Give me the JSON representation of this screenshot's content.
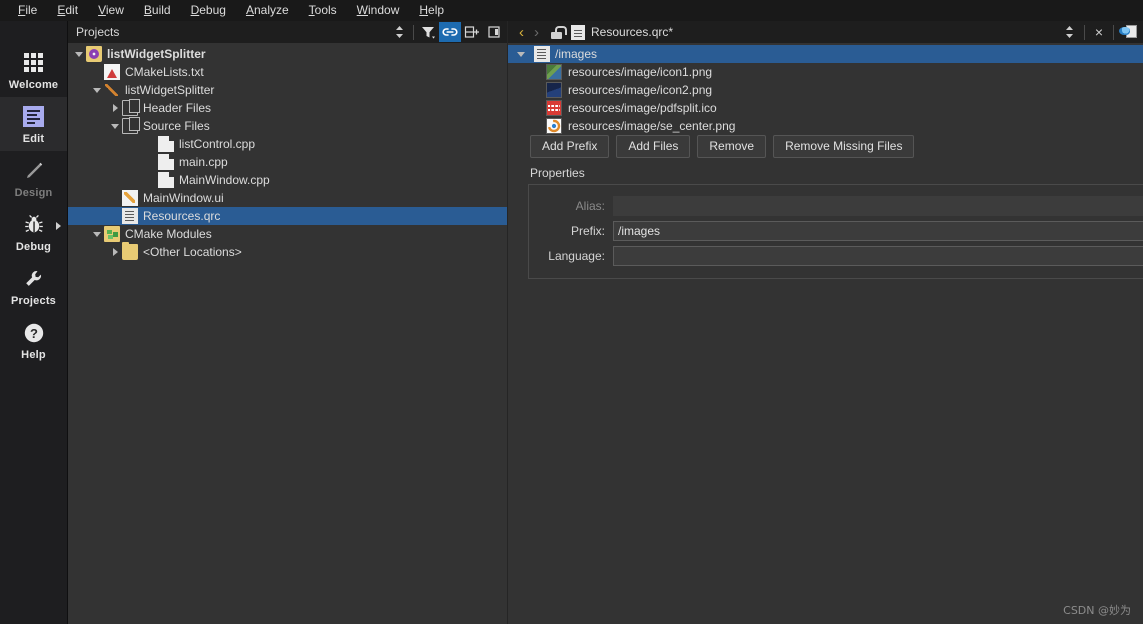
{
  "menubar": {
    "items": [
      {
        "pre": "",
        "mn": "F",
        "post": "ile"
      },
      {
        "pre": "",
        "mn": "E",
        "post": "dit"
      },
      {
        "pre": "",
        "mn": "V",
        "post": "iew"
      },
      {
        "pre": "",
        "mn": "B",
        "post": "uild"
      },
      {
        "pre": "",
        "mn": "D",
        "post": "ebug"
      },
      {
        "pre": "",
        "mn": "A",
        "post": "nalyze"
      },
      {
        "pre": "",
        "mn": "T",
        "post": "ools"
      },
      {
        "pre": "",
        "mn": "W",
        "post": "indow"
      },
      {
        "pre": "",
        "mn": "H",
        "post": "elp"
      }
    ]
  },
  "modebar": {
    "items": [
      {
        "label": "Welcome",
        "icon": "grid-icon",
        "state": "normal"
      },
      {
        "label": "Edit",
        "icon": "document-edit-icon",
        "state": "active"
      },
      {
        "label": "Design",
        "icon": "pencil-icon",
        "state": "disabled"
      },
      {
        "label": "Debug",
        "icon": "bug-icon",
        "state": "normal"
      },
      {
        "label": "Projects",
        "icon": "wrench-icon",
        "state": "normal"
      },
      {
        "label": "Help",
        "icon": "question-mark-icon",
        "state": "normal"
      }
    ]
  },
  "projects_panel": {
    "title": "Projects",
    "toolbar": [
      {
        "name": "sort-updown-icon",
        "active": false
      },
      {
        "name": "filter-funnel-icon",
        "active": false
      },
      {
        "name": "link-chain-icon",
        "active": true
      },
      {
        "name": "split-add-icon",
        "active": false
      },
      {
        "name": "close-panel-icon",
        "active": false
      }
    ],
    "tree": [
      {
        "label": "listWidgetSplitter",
        "indent": 0,
        "twist": "down",
        "icon": "project-gear-icon",
        "bold": true,
        "selected": false
      },
      {
        "label": "CMakeLists.txt",
        "indent": 1,
        "twist": "none",
        "icon": "cmake-file-icon",
        "bold": false,
        "selected": false
      },
      {
        "label": "listWidgetSplitter",
        "indent": 1,
        "twist": "down",
        "icon": "build-target-icon",
        "bold": false,
        "selected": false
      },
      {
        "label": "Header Files",
        "indent": 2,
        "twist": "right",
        "icon": "files-group-icon",
        "bold": false,
        "selected": false
      },
      {
        "label": "Source Files",
        "indent": 2,
        "twist": "down",
        "icon": "files-group-icon",
        "bold": false,
        "selected": false
      },
      {
        "label": "listControl.cpp",
        "indent": 4,
        "twist": "none",
        "icon": "cpp-file-icon",
        "bold": false,
        "selected": false
      },
      {
        "label": "main.cpp",
        "indent": 4,
        "twist": "none",
        "icon": "cpp-file-icon",
        "bold": false,
        "selected": false
      },
      {
        "label": "MainWindow.cpp",
        "indent": 4,
        "twist": "none",
        "icon": "cpp-file-icon",
        "bold": false,
        "selected": false
      },
      {
        "label": "MainWindow.ui",
        "indent": 2,
        "twist": "none",
        "icon": "ui-form-icon",
        "bold": false,
        "selected": false
      },
      {
        "label": "Resources.qrc",
        "indent": 2,
        "twist": "none",
        "icon": "qrc-file-icon",
        "bold": false,
        "selected": true
      },
      {
        "label": "CMake Modules",
        "indent": 1,
        "twist": "down",
        "icon": "cmake-modules-icon",
        "bold": false,
        "selected": false
      },
      {
        "label": "<Other Locations>",
        "indent": 2,
        "twist": "right",
        "icon": "folder-icon",
        "bold": false,
        "selected": false
      }
    ]
  },
  "editor": {
    "nav_back": "‹",
    "nav_forward": "›",
    "lock_icon": "unlocked-padlock-icon",
    "file_icon": "qrc-file-icon",
    "title": "Resources.qrc*",
    "sort_icon": "updown-arrows-icon",
    "close_label": "×",
    "split_icon": "split-editor-icon",
    "resource_tree": [
      {
        "label": "/images",
        "kind": "prefix",
        "twist": "down",
        "icon": "qrc-prefix-icon",
        "selected": true,
        "thumb": "#6aa84f"
      },
      {
        "label": "resources/image/icon1.png",
        "kind": "file",
        "twist": "none",
        "icon": "image-thumb-icon",
        "selected": false,
        "thumb": "icon1"
      },
      {
        "label": "resources/image/icon2.png",
        "kind": "file",
        "twist": "none",
        "icon": "image-thumb-icon",
        "selected": false,
        "thumb": "icon2"
      },
      {
        "label": "resources/image/pdfsplit.ico",
        "kind": "file",
        "twist": "none",
        "icon": "image-thumb-icon",
        "selected": false,
        "thumb": "pdfsplit"
      },
      {
        "label": "resources/image/se_center.png",
        "kind": "file",
        "twist": "none",
        "icon": "image-thumb-icon",
        "selected": false,
        "thumb": "se_center"
      }
    ],
    "buttons": [
      {
        "label": "Add Prefix"
      },
      {
        "label": "Add Files"
      },
      {
        "label": "Remove"
      },
      {
        "label": "Remove Missing Files"
      }
    ],
    "properties": {
      "section_label": "Properties",
      "fields": [
        {
          "label": "Alias:",
          "value": "",
          "disabled": true
        },
        {
          "label": "Prefix:",
          "value": "/images",
          "disabled": false
        },
        {
          "label": "Language:",
          "value": "",
          "disabled": false
        }
      ]
    }
  },
  "watermark": "CSDN @妙为",
  "colors": {
    "panel_bg": "#333333",
    "header_bg": "#1e1e1e",
    "sidebar_bg": "#1e1e20",
    "menubar_bg": "#191919",
    "selection_blue": "#2a5c94",
    "toolbar_active_blue": "#1d6bb0",
    "edit_icon_accent": "#a8abee",
    "nav_active_gold": "#d8b23c",
    "text": "#dcdcdc",
    "text_disabled": "#8a8a8a"
  }
}
